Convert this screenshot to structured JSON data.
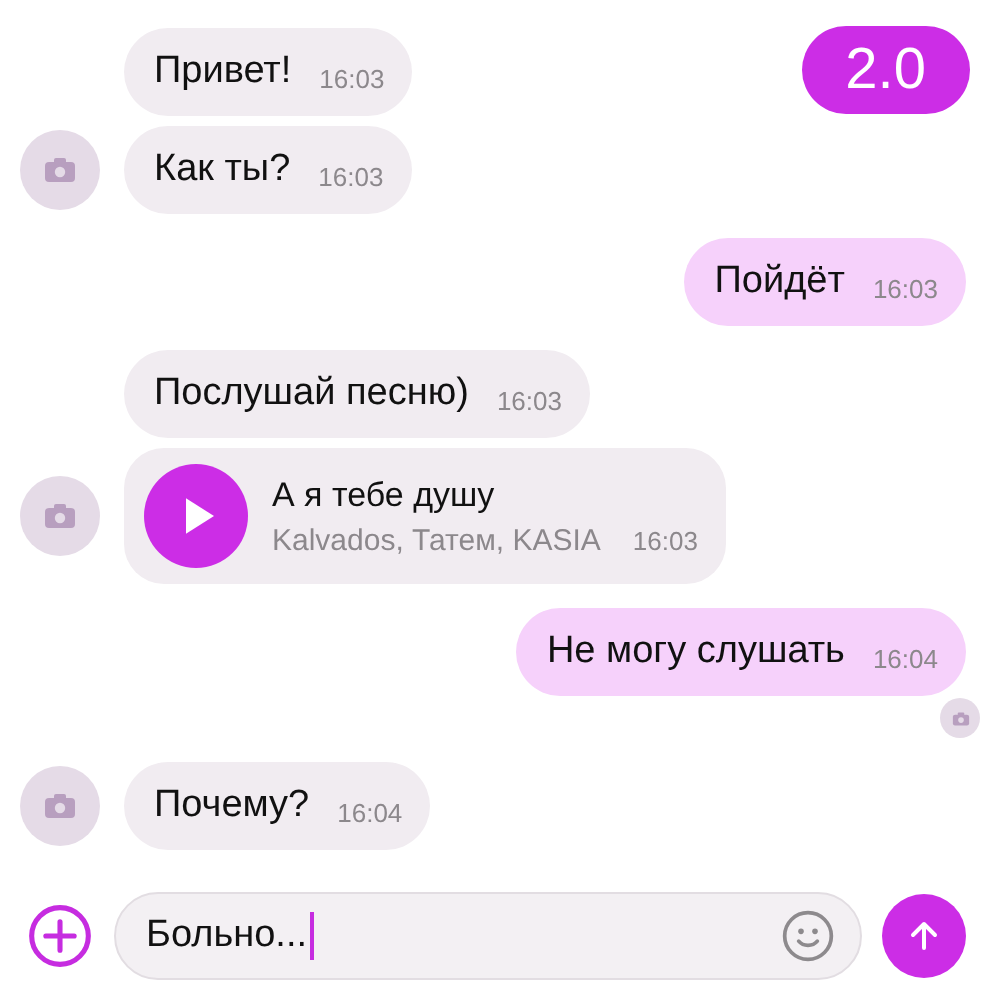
{
  "badge": "2.0",
  "groups": [
    {
      "kind": "incoming",
      "messages": [
        {
          "kind": "text",
          "text": "Привет!",
          "time": "16:03",
          "avatar": false
        },
        {
          "kind": "text",
          "text": "Как ты?",
          "time": "16:03",
          "avatar": true
        }
      ]
    },
    {
      "kind": "outgoing",
      "messages": [
        {
          "kind": "text",
          "text": "Пойдёт",
          "time": "16:03",
          "read": false
        }
      ]
    },
    {
      "kind": "incoming",
      "messages": [
        {
          "kind": "text",
          "text": "Послушай песню)",
          "time": "16:03",
          "avatar": false
        },
        {
          "kind": "song",
          "title": "А я тебе душу",
          "artists": "Kalvados, Татем, KASIA",
          "time": "16:03",
          "avatar": true
        }
      ]
    },
    {
      "kind": "outgoing",
      "messages": [
        {
          "kind": "text",
          "text": "Не могу слушать",
          "time": "16:04",
          "read": true
        }
      ]
    },
    {
      "kind": "incoming",
      "messages": [
        {
          "kind": "text",
          "text": "Почему?",
          "time": "16:04",
          "avatar": true
        }
      ]
    }
  ],
  "composer": {
    "value": "Больно..."
  }
}
